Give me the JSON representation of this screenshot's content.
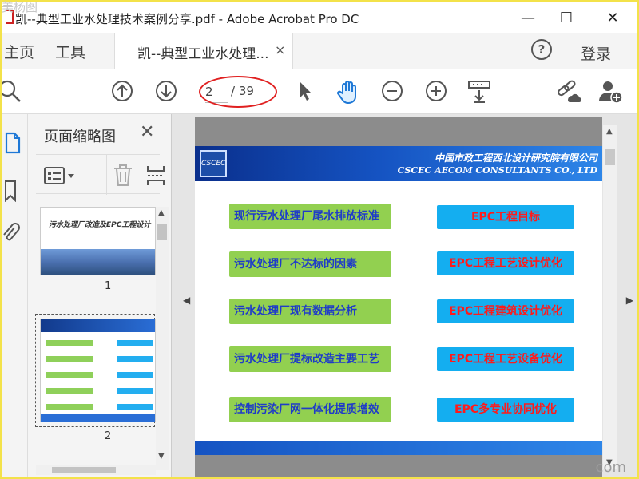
{
  "window": {
    "title": "凯--典型工业水处理技术案例分享.pdf - Adobe Acrobat Pro DC",
    "minimize": "—",
    "maximize": "☐",
    "close": "✕"
  },
  "watermark": {
    "top_left": "美杨图",
    "bottom_right": "com"
  },
  "menu": {
    "home": "主页",
    "tools": "工具",
    "doc_tab": "凯--典型工业水处理...",
    "doc_tab_close": "×",
    "help": "?",
    "login": "登录"
  },
  "toolbar": {
    "page_current": "2",
    "page_total": "/ 39"
  },
  "thumbnails": {
    "title": "页面缩略图",
    "close": "✕",
    "thumb1_title": "污水处理厂改造及EPC工程设计",
    "page1": "1",
    "page2": "2"
  },
  "slide": {
    "logo": "CSCEC",
    "banner_cn": "中国市政工程西北设计研究院有限公司",
    "banner_en": "CSCEC AECOM CONSULTANTS CO., LTD",
    "left_items": [
      "现行污水处理厂尾水排放标准",
      "污水处理厂不达标的因素",
      "污水处理厂现有数据分析",
      "污水处理厂提标改造主要工艺",
      "控制污染厂网一体化提质增效"
    ],
    "right_items": [
      "EPC工程目标",
      "EPC工程工艺设计优化",
      "EPC工程建筑设计优化",
      "EPC工程工艺设备优化",
      "EPC多专业协同优化"
    ]
  },
  "colors": {
    "accent_red": "#e02020",
    "green_box": "#92d050",
    "blue_box": "#14aef0",
    "banner_blue": "#1553c2"
  }
}
